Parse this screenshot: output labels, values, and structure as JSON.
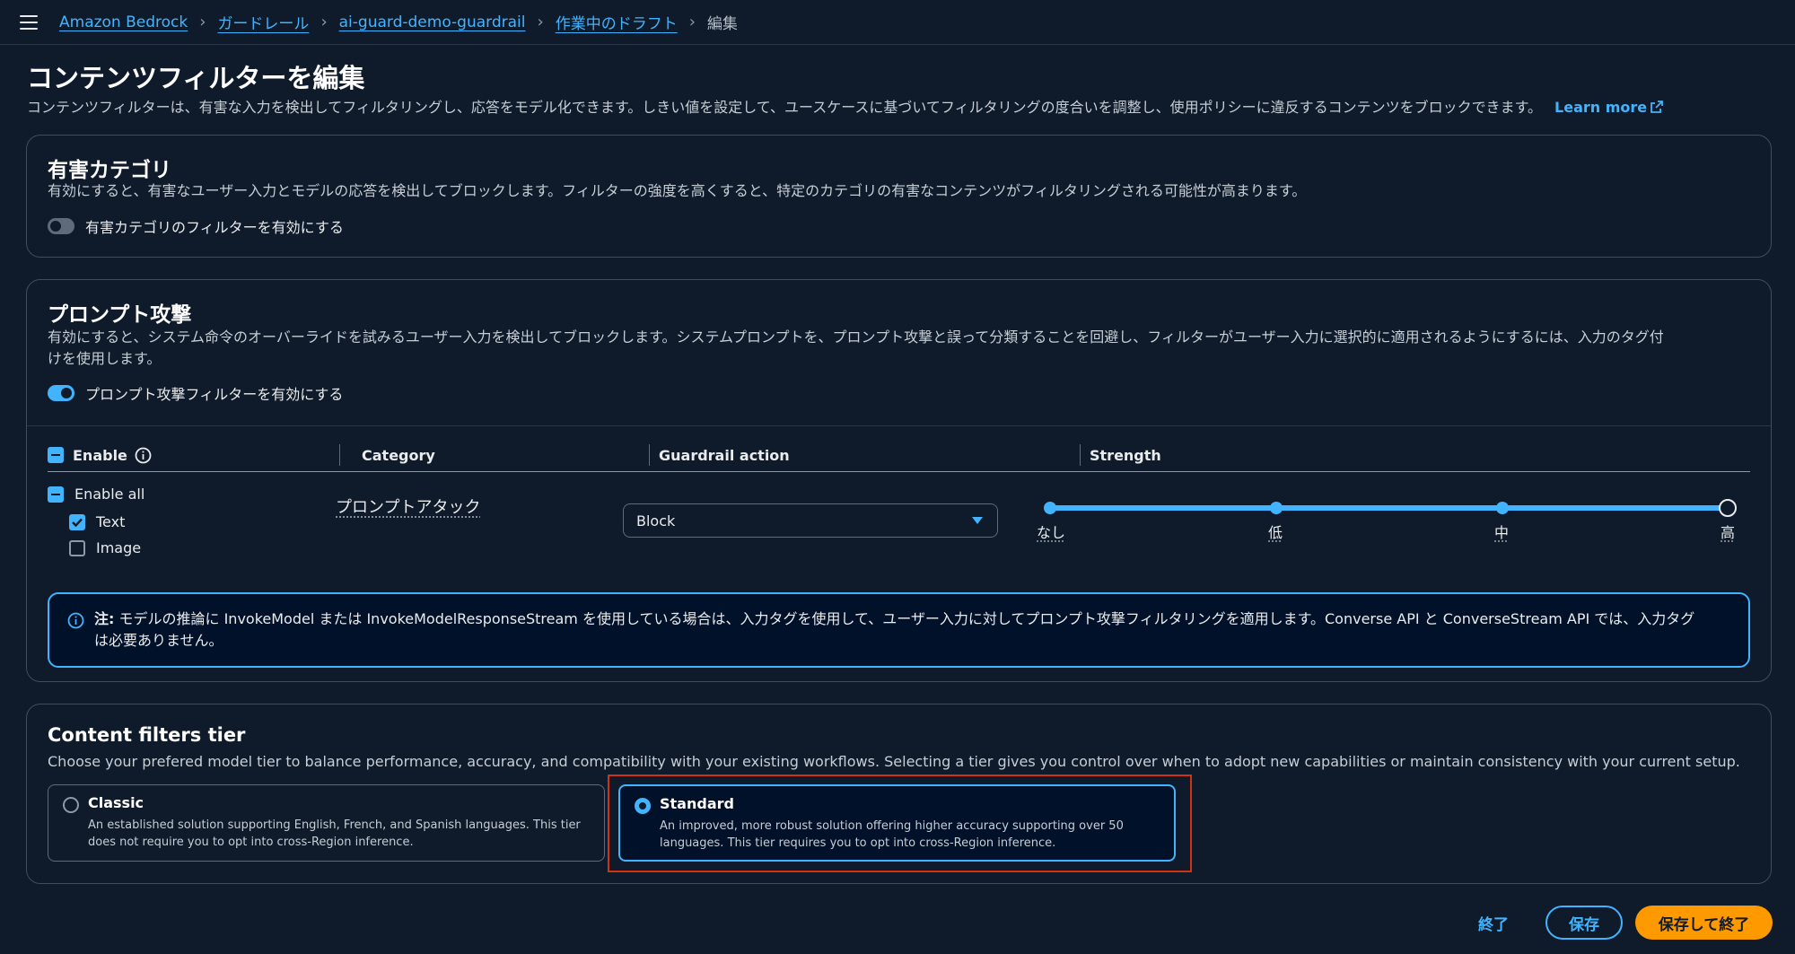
{
  "breadcrumbs": [
    {
      "label": "Amazon Bedrock"
    },
    {
      "label": "ガードレール"
    },
    {
      "label": "ai-guard-demo-guardrail"
    },
    {
      "label": "作業中のドラフト"
    },
    {
      "label": "編集"
    }
  ],
  "page": {
    "title": "コンテンツフィルターを編集",
    "description": "コンテンツフィルターは、有害な入力を検出してフィルタリングし、応答をモデル化できます。しきい値を設定して、ユースケースに基づいてフィルタリングの度合いを調整し、使用ポリシーに違反するコンテンツをブロックできます。",
    "learn_more": "Learn more"
  },
  "harmful": {
    "title": "有害カテゴリ",
    "description": "有効にすると、有害なユーザー入力とモデルの応答を検出してブロックします。フィルターの強度を高くすると、特定のカテゴリの有害なコンテンツがフィルタリングされる可能性が高まります。",
    "toggle_label": "有害カテゴリのフィルターを有効にする",
    "enabled": false
  },
  "prompt_attack": {
    "title": "プロンプト攻撃",
    "description_line1": "有効にすると、システム命令のオーバーライドを試みるユーザー入力を検出してブロックします。システムプロンプトを、プロンプト攻撃と誤って分類することを回避し、フィルターがユーザー入力に選択的に適用されるようにするには、入力のタグ付",
    "description_line2": "けを使用します。",
    "toggle_label": "プロンプト攻撃フィルターを有効にする",
    "enabled": true,
    "table": {
      "headers": {
        "enable": "Enable",
        "category": "Category",
        "action": "Guardrail action",
        "strength": "Strength"
      },
      "enable_all": "Enable all",
      "text_label": "Text",
      "text_checked": true,
      "image_label": "Image",
      "image_checked": false,
      "category": "プロンプトアタック",
      "action": "Block",
      "strength_levels": [
        "なし",
        "低",
        "中",
        "高"
      ],
      "strength_selected": "高",
      "strength_value": 3
    },
    "note_label": "注:",
    "note_line1": "モデルの推論に InvokeModel または InvokeModelResponseStream を使用している場合は、入力タグを使用して、ユーザー入力に対してプロンプト攻撃フィルタリングを適用します。Converse API と ConverseStream API では、入力タグ",
    "note_line2": "は必要ありません。"
  },
  "tier": {
    "title": "Content filters tier",
    "description": "Choose your prefered model tier to balance performance, accuracy, and compatibility with your existing workflows. Selecting a tier gives you control over when to adopt new capabilities or maintain consistency with your current setup.",
    "options": [
      {
        "title": "Classic",
        "line1": "An established solution supporting English, French, and Spanish languages. This tier",
        "line2": "does not require you to opt into cross-Region inference.",
        "selected": false
      },
      {
        "title": "Standard",
        "line1": "An improved, more robust solution offering higher accuracy supporting over 50",
        "line2": "languages. This tier requires you to opt into cross-Region inference.",
        "selected": true
      }
    ]
  },
  "footer": {
    "cancel": "終了",
    "save": "保存",
    "save_exit": "保存して終了"
  },
  "colors": {
    "background": "#0f1b2a",
    "accent": "#42b4ff",
    "primary_button": "#ff9900",
    "highlight": "#d13212"
  }
}
